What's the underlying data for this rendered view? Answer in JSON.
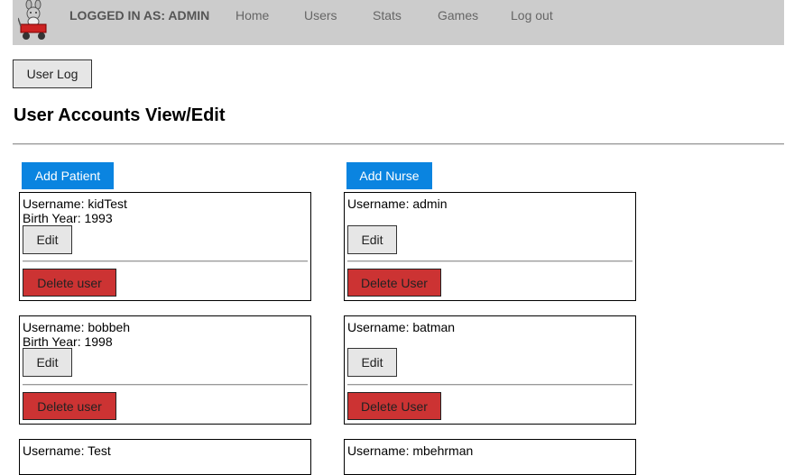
{
  "header": {
    "logged_in": "LOGGED IN AS: ADMIN",
    "nav": [
      "Home",
      "Users",
      "Stats",
      "Games",
      "Log out"
    ],
    "logo_icon": "rabbit-in-wagon-logo"
  },
  "toolbar": {
    "user_log": "User Log"
  },
  "page": {
    "title": "User Accounts View/Edit"
  },
  "patients": {
    "add_label": "Add Patient",
    "cards": [
      {
        "username": "Username: kidTest",
        "birth": "Birth Year: 1993",
        "edit": "Edit",
        "delete": "Delete user"
      },
      {
        "username": "Username: bobbeh",
        "birth": "Birth Year: 1998",
        "edit": "Edit",
        "delete": "Delete user"
      },
      {
        "username": "Username: Test"
      }
    ]
  },
  "nurses": {
    "add_label": "Add Nurse",
    "cards": [
      {
        "username": "Username: admin",
        "edit": "Edit",
        "delete": "Delete User"
      },
      {
        "username": "Username: batman",
        "edit": "Edit",
        "delete": "Delete User"
      },
      {
        "username": "Username: mbehrman"
      }
    ]
  },
  "colors": {
    "nav_bg": "#cccccc",
    "primary": "#0a84e0",
    "danger": "#cc3333"
  }
}
